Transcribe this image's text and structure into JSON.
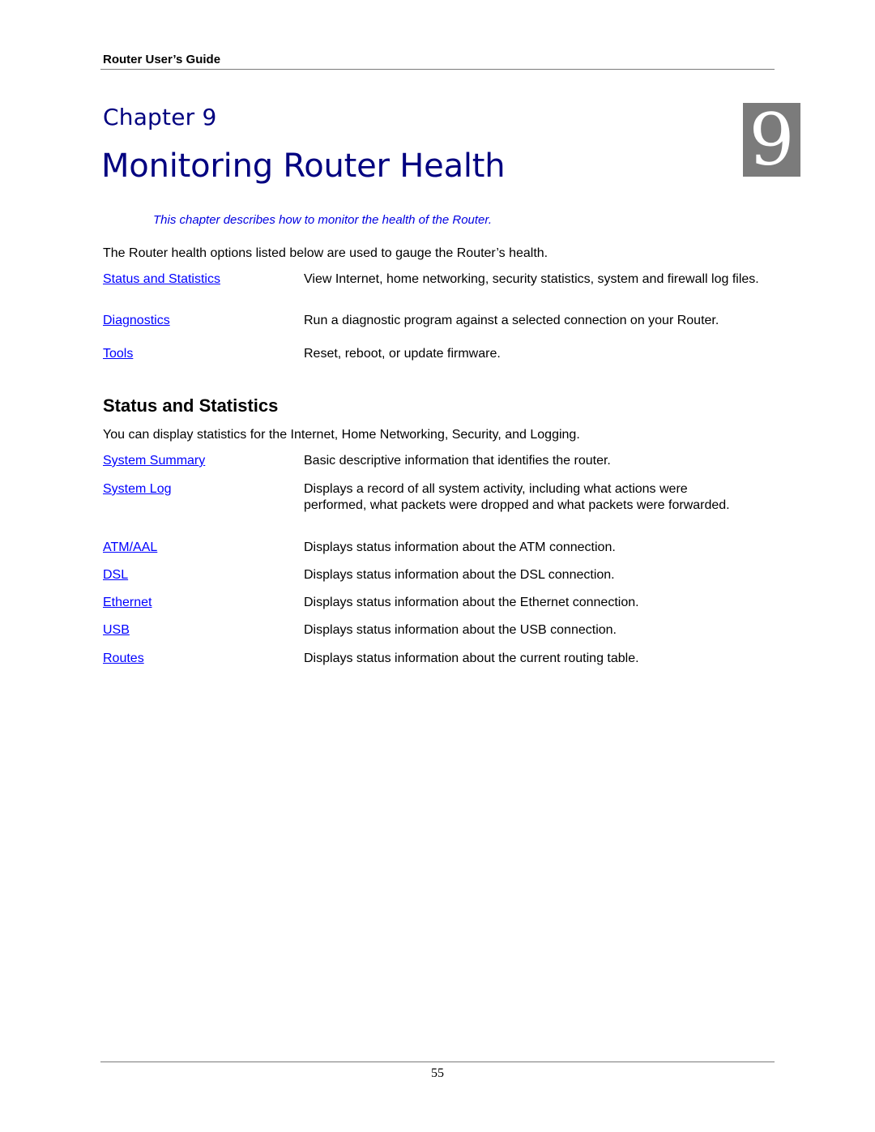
{
  "header": {
    "running_title": "Router User’s Guide"
  },
  "chapter": {
    "label": "Chapter 9",
    "title": "Monitoring Router Health",
    "badge_number": "9",
    "badge_color": "#7b7b7b",
    "title_color": "#000080",
    "summary": "This chapter describes how to monitor the health of the Router."
  },
  "intro": {
    "text": "The Router health options listed below are used to gauge the Router’s health.",
    "options": [
      {
        "link": "Status and Statistics",
        "description": "View Internet, home networking, security statistics, system and firewall log files."
      },
      {
        "link": "Diagnostics",
        "description": "Run a diagnostic program against a selected connection on your Router."
      },
      {
        "link": "Tools",
        "description": "Reset, reboot, or update firmware."
      }
    ]
  },
  "status_section": {
    "heading": "Status and Statistics",
    "text": "You can display statistics for the Internet, Home Networking, Security, and Logging.",
    "items": [
      {
        "link": "System Summary",
        "description": "Basic descriptive information that identifies the router."
      },
      {
        "link": "System Log",
        "description": "Displays a record of all system activity, including what actions were performed, what packets were dropped and what packets were forwarded."
      },
      {
        "link": "ATM/AAL",
        "description": "Displays status information about the ATM connection."
      },
      {
        "link": "DSL",
        "description": "Displays status information about the DSL connection."
      },
      {
        "link": "Ethernet",
        "description": "Displays status information about the Ethernet connection."
      },
      {
        "link": "USB",
        "description": "Displays status information about the USB connection."
      },
      {
        "link": "Routes",
        "description": "Displays status information about the current routing table."
      }
    ]
  },
  "footer": {
    "page_number": "55"
  },
  "colors": {
    "link": "#0000ff",
    "summary_italic": "#0000e0",
    "rule": "#7a7a7a"
  }
}
